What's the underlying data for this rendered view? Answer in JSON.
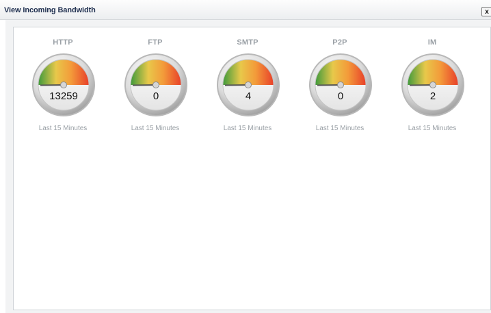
{
  "window": {
    "title": "View Incoming Bandwidth",
    "close_label": "x"
  },
  "gauges": [
    {
      "label": "HTTP",
      "value": "13259",
      "caption": "Last 15 Minutes",
      "needle_level": 0.0
    },
    {
      "label": "FTP",
      "value": "0",
      "caption": "Last 15 Minutes",
      "needle_level": 0.0
    },
    {
      "label": "SMTP",
      "value": "4",
      "caption": "Last 15 Minutes",
      "needle_level": 0.0
    },
    {
      "label": "P2P",
      "value": "0",
      "caption": "Last 15 Minutes",
      "needle_level": 0.0
    },
    {
      "label": "IM",
      "value": "2",
      "caption": "Last 15 Minutes",
      "needle_level": 0.0
    }
  ],
  "colors": {
    "green": "#3f9a3c",
    "yellow": "#e8c84a",
    "orange": "#f39a3a",
    "red": "#e8402a",
    "title": "#1f2f4f",
    "label": "#9aa0a6"
  }
}
